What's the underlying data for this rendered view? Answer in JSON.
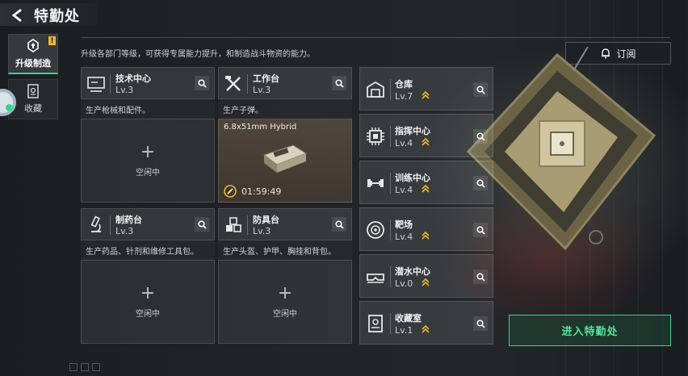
{
  "header": {
    "title": "特勤处"
  },
  "sidebar": {
    "tabs": [
      {
        "label": "升级制造",
        "active": true,
        "badge": "!"
      },
      {
        "label": "收藏",
        "active": false
      }
    ]
  },
  "description": "升级各部门等级，可获得专属能力提升，和制造战斗物资的能力。",
  "subscribe_label": "订阅",
  "workstations": [
    {
      "name": "技术中心",
      "level": "Lv.3",
      "desc": "生产枪械和配件。",
      "status": "空闲中",
      "icon": "monitor-icon"
    },
    {
      "name": "工作台",
      "level": "Lv.3",
      "desc": "生产子弹。",
      "crafting_item": "6.8x51mm Hybrid",
      "timer": "01:59:49",
      "icon": "tools-icon"
    },
    {
      "name": "制药台",
      "level": "Lv.3",
      "desc": "生产药品、针剂和维修工具包。",
      "status": "空闲中",
      "icon": "microscope-icon"
    },
    {
      "name": "防具台",
      "level": "Lv.3",
      "desc": "生产头盔、护甲、胸挂和背包。",
      "status": "空闲中",
      "icon": "cubes-icon"
    }
  ],
  "facilities": [
    {
      "name": "仓库",
      "level": "Lv.7",
      "icon": "warehouse-icon"
    },
    {
      "name": "指挥中心",
      "level": "Lv.4",
      "icon": "chip-icon"
    },
    {
      "name": "训练中心",
      "level": "Lv.4",
      "icon": "dumbbell-icon"
    },
    {
      "name": "靶场",
      "level": "Lv.4",
      "icon": "target-icon"
    },
    {
      "name": "潜水中心",
      "level": "Lv.0",
      "icon": "diving-mask-icon"
    },
    {
      "name": "收藏室",
      "level": "Lv.1",
      "icon": "display-case-icon"
    }
  ],
  "enter_button": "进入特勤处",
  "colors": {
    "accent": "#3fd28a",
    "upgrade": "#e8b92c"
  }
}
